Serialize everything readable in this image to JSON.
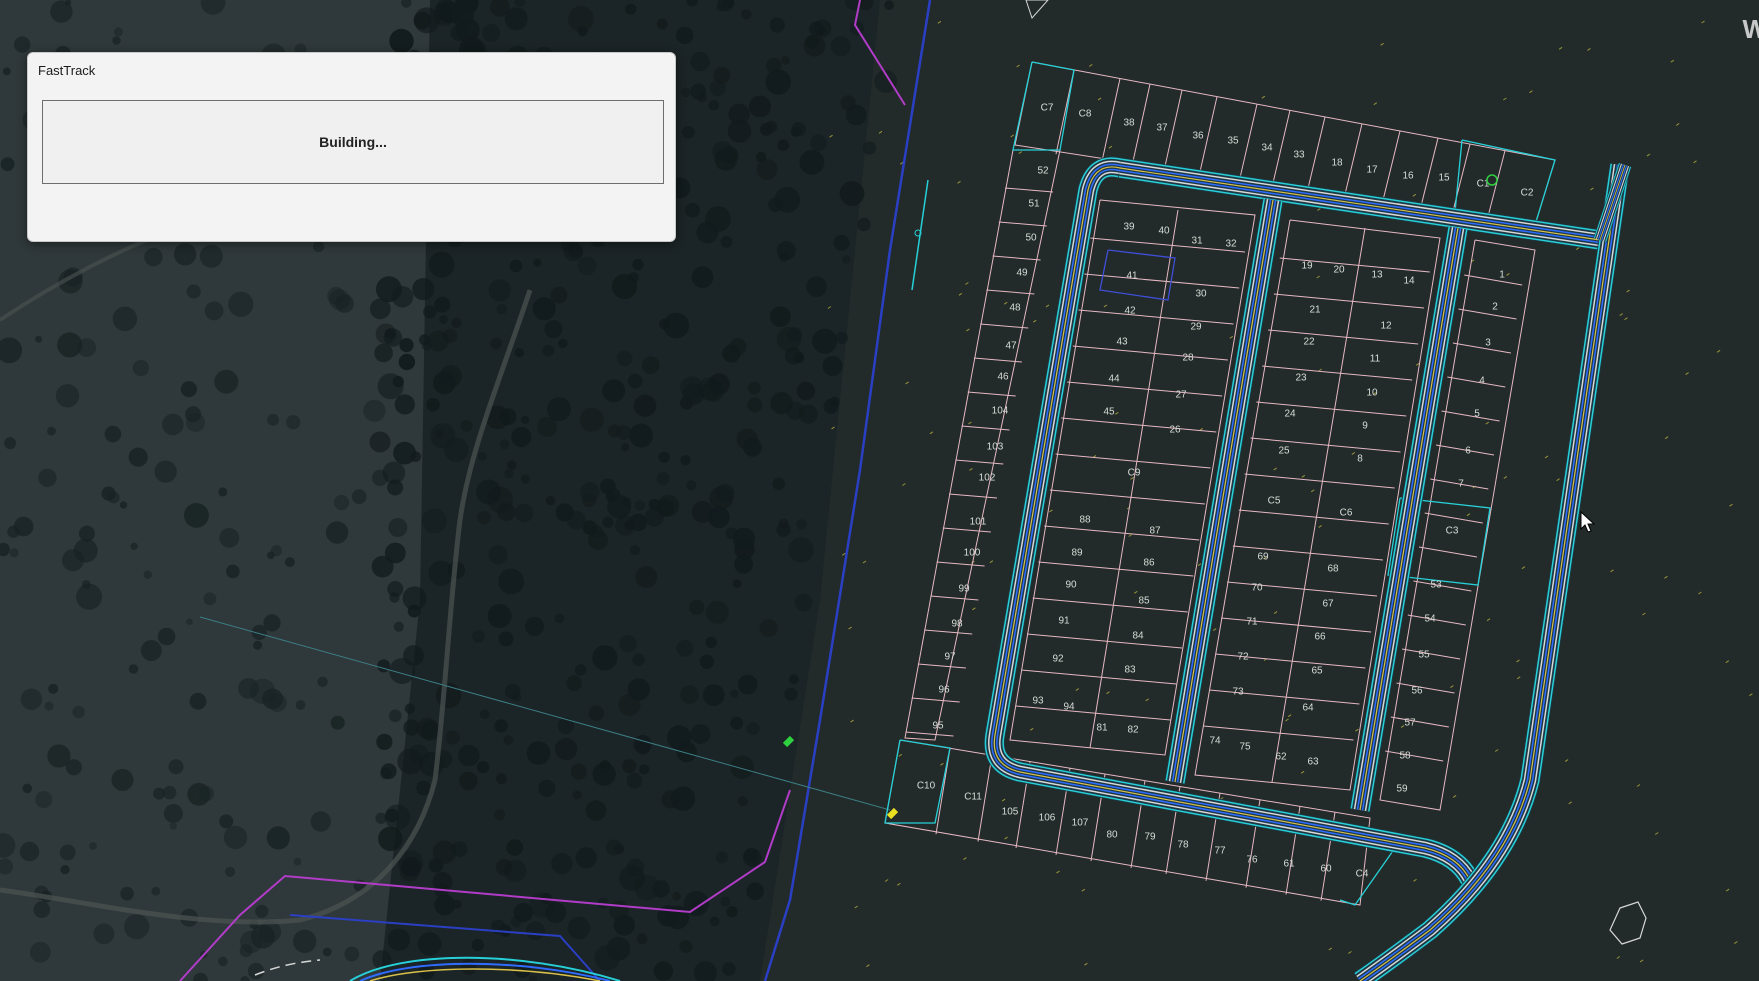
{
  "dialog": {
    "title": "FastTrack",
    "status": "Building..."
  },
  "watermark": "W",
  "colors": {
    "lot_outline": "#e6b8c4",
    "road_cyan": "#27d0d8",
    "road_blue": "#2f6cff",
    "road_yellow": "#d8c04a",
    "road_white": "#d8d8d8",
    "boundary_magenta": "#b13cc8",
    "boundary_blue": "#2a3fc4",
    "dialog_bg": "#f3f3f3"
  },
  "lots": [
    "C7",
    "C8",
    "38",
    "37",
    "36",
    "35",
    "34",
    "33",
    "18",
    "17",
    "16",
    "15",
    "C1",
    "C2",
    "52",
    "51",
    "50",
    "49",
    "48",
    "47",
    "46",
    "104",
    "103",
    "102",
    "101",
    "100",
    "99",
    "98",
    "97",
    "96",
    "95",
    "39",
    "40",
    "31",
    "32",
    "41",
    "30",
    "42",
    "29",
    "43",
    "28",
    "44",
    "27",
    "45",
    "26",
    "C9",
    "88",
    "87",
    "89",
    "86",
    "90",
    "85",
    "91",
    "84",
    "92",
    "83",
    "93",
    "94",
    "81",
    "82",
    "19",
    "20",
    "13",
    "14",
    "21",
    "12",
    "22",
    "11",
    "23",
    "10",
    "24",
    "9",
    "25",
    "8",
    "C5",
    "C6",
    "69",
    "68",
    "70",
    "67",
    "71",
    "66",
    "72",
    "65",
    "73",
    "64",
    "74",
    "75",
    "62",
    "63",
    "1",
    "2",
    "3",
    "4",
    "5",
    "6",
    "7",
    "C3",
    "53",
    "54",
    "55",
    "56",
    "57",
    "58",
    "59",
    "C10",
    "C11",
    "105",
    "106",
    "107",
    "80",
    "79",
    "78",
    "77",
    "76",
    "61",
    "60",
    "C4"
  ]
}
